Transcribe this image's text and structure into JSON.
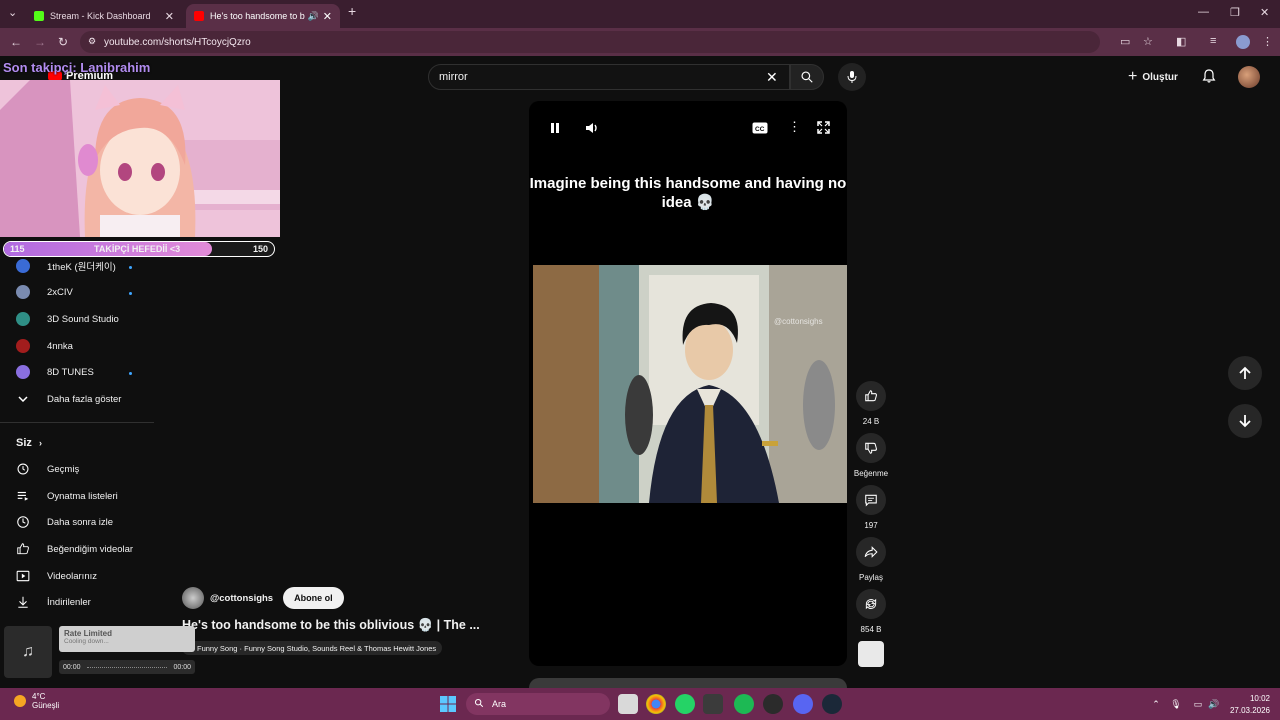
{
  "browser": {
    "tabs": [
      {
        "title": "Stream - Kick Dashboard",
        "favicon_color": "#53fc18"
      },
      {
        "title": "He's too handsome to be t",
        "favicon_color": "#ff0000",
        "active": true
      }
    ],
    "url": "youtube.com/shorts/HTcoycjQzro"
  },
  "overlay": {
    "follower_title": "Son takipçi: Lanibrahim",
    "goal_label": "TAKİPÇİ HEFEDİİ <3",
    "goal_current": "115",
    "goal_target": "150",
    "goal_fraction": 0.77,
    "brand": "Premium"
  },
  "masthead": {
    "search_value": "mirror",
    "create_label": "Oluştur"
  },
  "sidebar": {
    "subscriptions": [
      {
        "name": "1theK (원더케이)",
        "live": true,
        "color": "#3a6bd6"
      },
      {
        "name": "2xCIV",
        "live": true,
        "color": "#7a8bb0"
      },
      {
        "name": "3D Sound Studio",
        "live": false,
        "color": "#2f8f86"
      },
      {
        "name": "4nnka",
        "live": false,
        "color": "#a21d1d"
      },
      {
        "name": "8D TUNES",
        "live": true,
        "color": "#8a6fe0"
      }
    ],
    "show_more": "Daha fazla göster",
    "you_header": "Siz",
    "you_items": [
      {
        "label": "Geçmiş",
        "icon": "history-icon"
      },
      {
        "label": "Oynatma listeleri",
        "icon": "playlist-icon"
      },
      {
        "label": "Daha sonra izle",
        "icon": "clock-icon"
      },
      {
        "label": "Beğendiğim videolar",
        "icon": "thumbs-up-icon"
      },
      {
        "label": "Videolarınız",
        "icon": "video-icon"
      },
      {
        "label": "İndirilenler",
        "icon": "download-icon"
      }
    ]
  },
  "short": {
    "caption": "Imagine being this handsome and having no idea 💀",
    "watermark": "@cottonsighs",
    "channel": "@cottonsighs",
    "subscribe_label": "Abone ol",
    "title": "He's too handsome to be this oblivious 💀 | The ...",
    "music": "Funny Song · Funny Song Studio, Sounds Reel & Thomas Hewitt Jones",
    "like_count": "24 B",
    "dislike_label": "Beğenme",
    "comment_count": "197",
    "share_label": "Paylaş",
    "remix_count": "854 B"
  },
  "music_widget": {
    "title": "Rate Limited",
    "subtitle": "Cooling down...",
    "time_start": "00:00",
    "time_end": "00:00"
  },
  "taskbar": {
    "temperature": "4°C",
    "weather": "Güneşli",
    "search_placeholder": "Ara",
    "time": "10:02",
    "date": "27.03.2026"
  }
}
